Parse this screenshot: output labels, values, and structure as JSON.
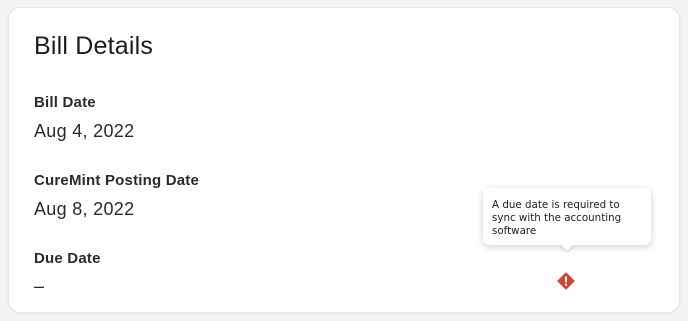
{
  "card": {
    "title": "Bill Details",
    "fields": [
      {
        "label": "Bill Date",
        "value": "Aug 4, 2022"
      },
      {
        "label": "CureMint Posting Date",
        "value": "Aug 8, 2022"
      },
      {
        "label": "Due Date",
        "value": "–"
      }
    ]
  },
  "tooltip": {
    "text": "A due date is required to sync with the accounting software"
  },
  "warning_icon": {
    "name": "warning-diamond-icon",
    "color": "#d2462f"
  }
}
